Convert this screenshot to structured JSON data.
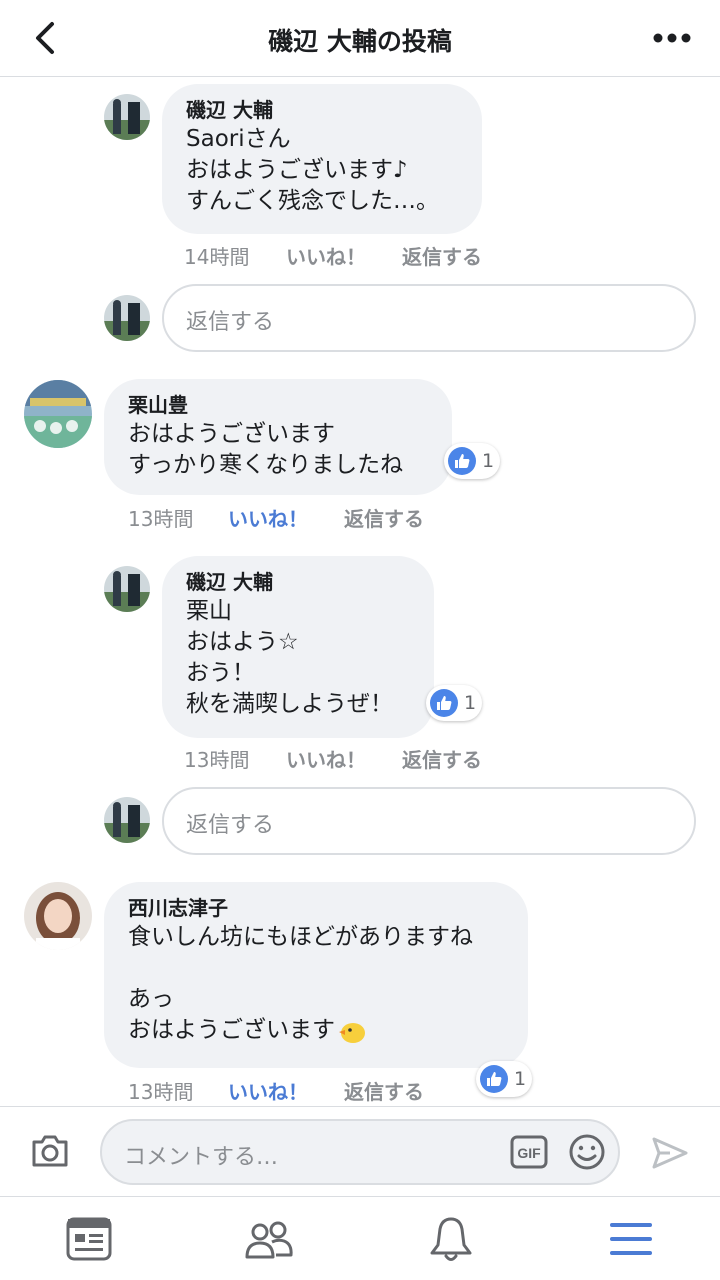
{
  "header": {
    "title": "磯辺 大輔の投稿"
  },
  "comments": [
    {
      "name": "磯辺 大輔",
      "lines": [
        "Saoriさん",
        "おはようございます♪",
        "すんごく残念でした…。"
      ],
      "time": "14時間",
      "like_label": "いいね！",
      "reply_label": "返信する"
    },
    {
      "name": "栗山豊",
      "lines": [
        "おはようございます",
        "すっかり寒くなりましたね"
      ],
      "reaction_count": "1",
      "time": "13時間",
      "like_label": "いいね！",
      "reply_label": "返信する"
    },
    {
      "name": "磯辺 大輔",
      "lines": [
        "栗山",
        "おはよう☆",
        "おう！",
        "秋を満喫しようぜ！"
      ],
      "reaction_count": "1",
      "time": "13時間",
      "like_label": "いいね！",
      "reply_label": "返信する"
    },
    {
      "name": "西川志津子",
      "lines": [
        "食いしん坊にもほどがありますね",
        "",
        "あっ",
        "おはようございます"
      ],
      "reaction_count": "1",
      "time": "13時間",
      "like_label": "いいね！",
      "reply_label": "返信する"
    }
  ],
  "reply_boxes": [
    {
      "placeholder": "返信する"
    },
    {
      "placeholder": "返信する"
    }
  ],
  "composer": {
    "placeholder": "コメントする…",
    "gif_label": "GIF"
  },
  "tabs": [
    {
      "icon": "news-feed-icon"
    },
    {
      "icon": "friends-icon"
    },
    {
      "icon": "notifications-bell-icon"
    },
    {
      "icon": "menu-icon"
    }
  ],
  "colors": {
    "accent": "#4b7bd4",
    "bubble": "#f0f2f5",
    "reaction": "#4b85e8"
  }
}
